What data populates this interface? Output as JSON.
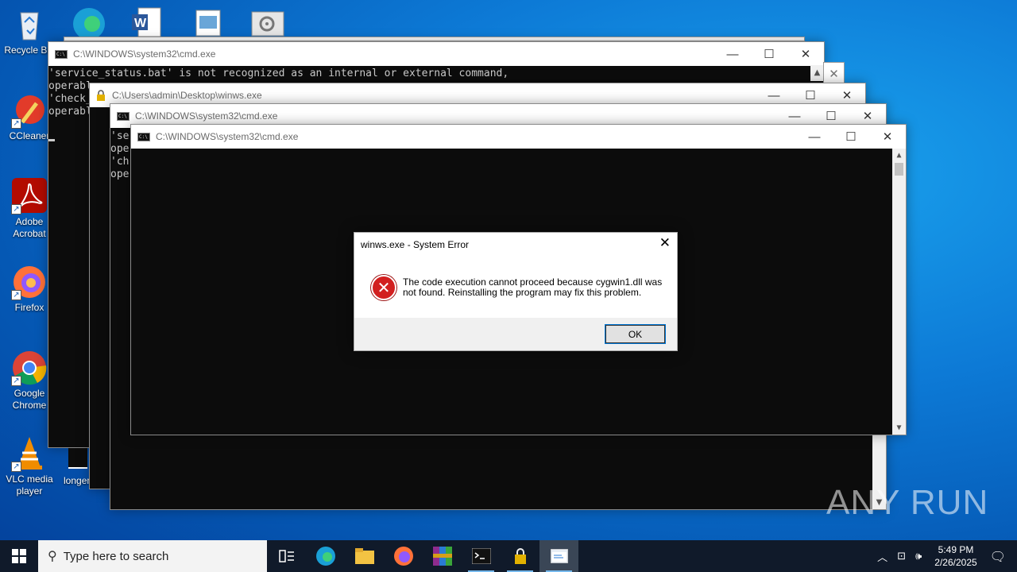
{
  "desktop": {
    "icons": [
      {
        "label": "Recycle Bin",
        "icon": "recycle-bin-icon"
      },
      {
        "label": "CCleaner",
        "icon": "ccleaner-icon"
      },
      {
        "label": "Adobe Acrobat",
        "icon": "acrobat-icon"
      },
      {
        "label": "Firefox",
        "icon": "firefox-icon"
      },
      {
        "label": "Google Chrome",
        "icon": "chrome-icon"
      },
      {
        "label": "VLC media player",
        "icon": "vlc-icon"
      },
      {
        "label": "longer"
      }
    ]
  },
  "windows": {
    "cmd1": {
      "title": "C:\\WINDOWS\\system32\\cmd.exe",
      "lines": "'service_status.bat' is not recognized as an internal or external command,\noperabl\n'check_\noperabl"
    },
    "winws": {
      "title": "C:\\Users\\admin\\Desktop\\winws.exe"
    },
    "cmd2": {
      "title": "C:\\WINDOWS\\system32\\cmd.exe",
      "lines": "'se\nope\n'ch\nope"
    },
    "cmd3": {
      "title": "C:\\WINDOWS\\system32\\cmd.exe"
    }
  },
  "dialog": {
    "title": "winws.exe - System Error",
    "message": "The code execution cannot proceed because cygwin1.dll was not found. Reinstalling the program may fix this problem.",
    "ok": "OK"
  },
  "taskbar": {
    "search_placeholder": "Type here to search",
    "time": "5:49 PM",
    "date": "2/26/2025"
  },
  "watermark": "ANY RUN",
  "colors": {
    "desktop": "#0d7ad6",
    "taskbar": "#101a2a",
    "error": "#d21f1f"
  }
}
